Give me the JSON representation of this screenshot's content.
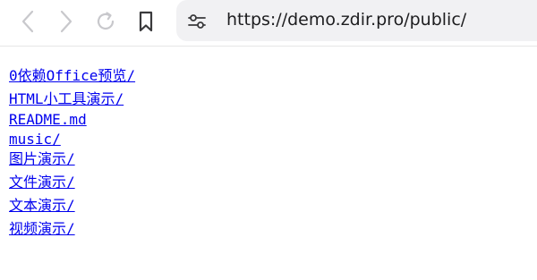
{
  "browser": {
    "url": "https://demo.zdir.pro/public/",
    "icons": {
      "back": "chevron-left-icon",
      "forward": "chevron-right-icon",
      "reload": "reload-icon",
      "bookmark": "bookmark-icon",
      "site_settings": "sliders-icon"
    },
    "colors": {
      "disabled_icon": "#c8c8cc",
      "active_icon": "#3a3a3c",
      "urlbar_bg": "#f1f1f3",
      "link": "#0000ee"
    }
  },
  "listing": {
    "items": [
      {
        "label": "0依赖Office预览/"
      },
      {
        "label": "HTML小工具演示/"
      },
      {
        "label": "README.md"
      },
      {
        "label": "music/"
      },
      {
        "label": "图片演示/"
      },
      {
        "label": "文件演示/"
      },
      {
        "label": "文本演示/"
      },
      {
        "label": "视频演示/"
      }
    ]
  }
}
